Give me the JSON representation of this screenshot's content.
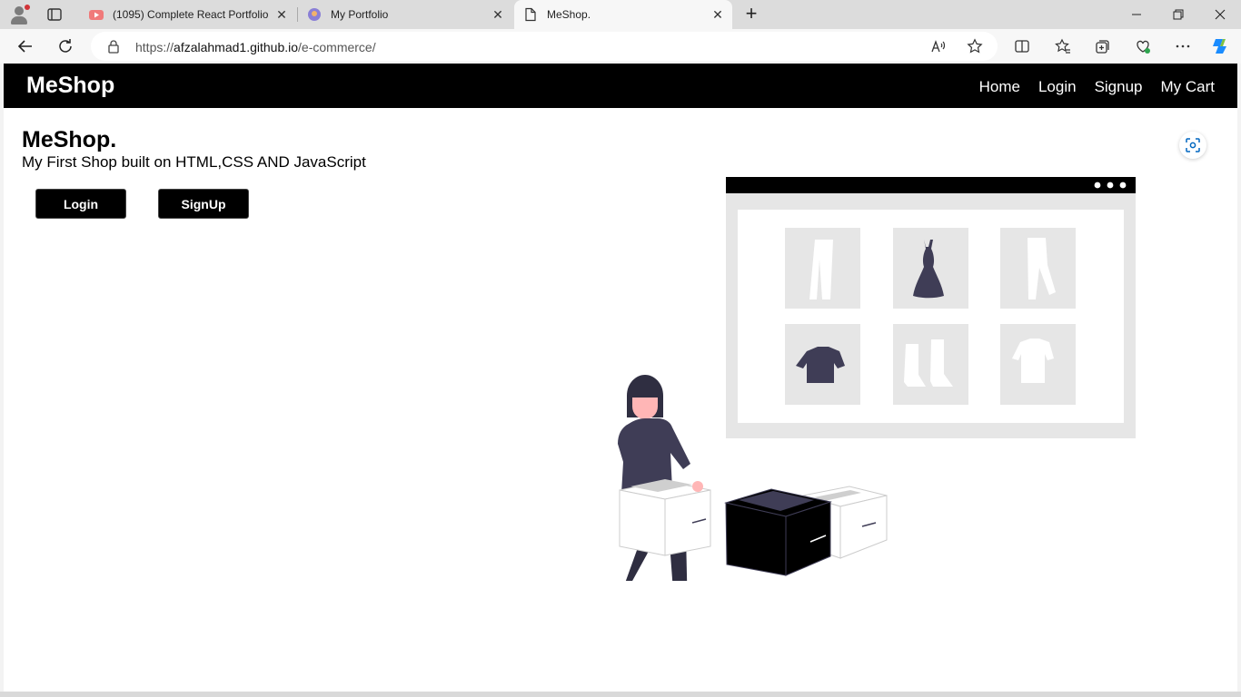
{
  "browser": {
    "tabs": [
      {
        "title": "(1095) Complete React Portfolio",
        "favicon": "youtube-icon",
        "active": false
      },
      {
        "title": "My Portfolio",
        "favicon": "portfolio-icon",
        "active": false
      },
      {
        "title": "MeShop.",
        "favicon": "page-icon",
        "active": true
      }
    ],
    "url": {
      "scheme": "https://",
      "host": "afzalahmad1.github.io",
      "path": "/e-commerce/"
    },
    "colors": {
      "accent": "#0067c0",
      "tabstrip": "#dcdcdc",
      "youtube": "#ff0000"
    }
  },
  "page": {
    "navbar": {
      "brand": "MeShop",
      "links": [
        "Home",
        "Login",
        "Signup",
        "My Cart"
      ]
    },
    "hero": {
      "title": "MeShop.",
      "subtitle": "My First Shop built on HTML,CSS AND JavaScript",
      "login_label": "Login",
      "signup_label": "SignUp"
    },
    "colors": {
      "primary": "#000000",
      "figure": "#3f3d56",
      "tile": "#e6e6e6",
      "skin": "#ffb6b6"
    }
  }
}
